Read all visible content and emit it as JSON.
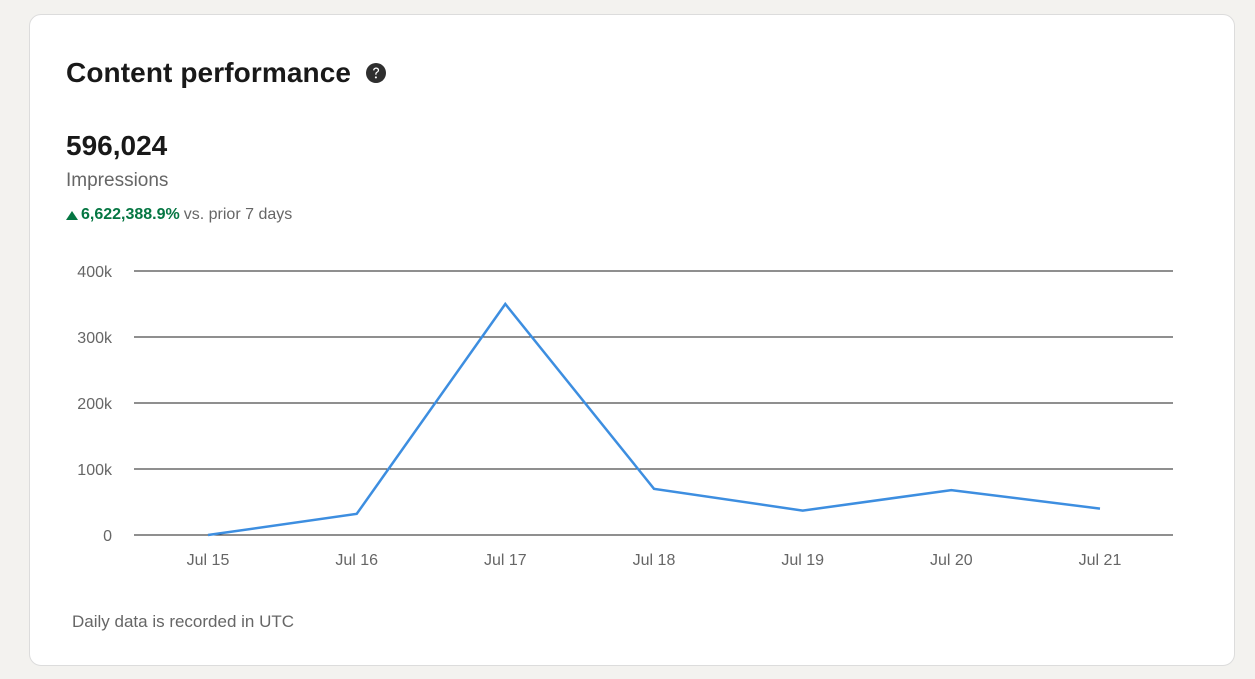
{
  "card": {
    "title": "Content performance",
    "help_icon": "question-circle-icon",
    "metric": {
      "value": "596,024",
      "label": "Impressions",
      "change_value": "6,622,388.9%",
      "change_suffix": "vs. prior 7 days",
      "change_direction": "up"
    },
    "footnote": "Daily data is recorded in UTC"
  },
  "colors": {
    "line": "#3d8ee0",
    "positive": "#057642",
    "grid": "#1f1f1f",
    "muted_text": "#666666"
  },
  "chart_data": {
    "type": "line",
    "x": [
      "Jul 15",
      "Jul 16",
      "Jul 17",
      "Jul 18",
      "Jul 19",
      "Jul 20",
      "Jul 21"
    ],
    "series": [
      {
        "values": [
          0,
          32000,
          350000,
          70000,
          37000,
          68000,
          40000
        ]
      }
    ],
    "y_ticks": [
      0,
      100000,
      200000,
      300000,
      400000
    ],
    "y_tick_labels": [
      "0",
      "100k",
      "200k",
      "300k",
      "400k"
    ],
    "ylim": [
      0,
      400000
    ],
    "grid": "horizontal",
    "legend": "none"
  }
}
